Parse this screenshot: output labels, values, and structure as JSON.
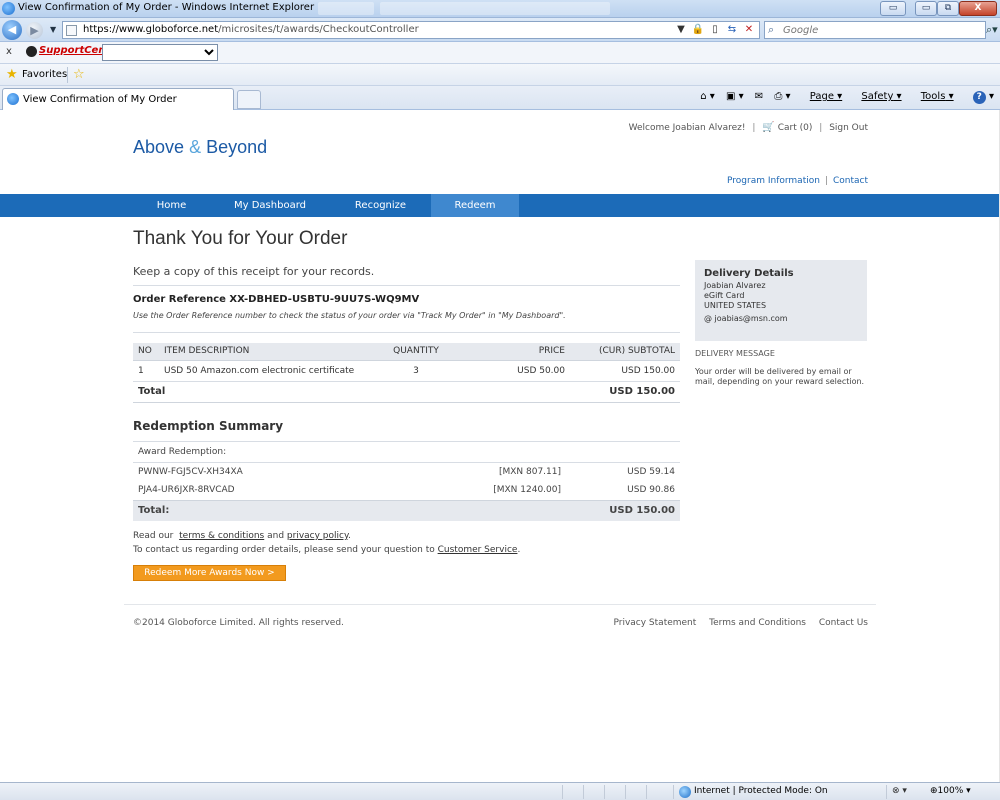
{
  "window": {
    "title": "View Confirmation of My Order - Windows Internet Explorer",
    "minimize": "▭",
    "restore": "⧉",
    "close": "X"
  },
  "address": {
    "url_host": "https://www.globoforce.net",
    "url_path": "/microsites/t/awards/CheckoutController",
    "search_placeholder": "Google"
  },
  "links_bar": {
    "close": "x",
    "label": "SupportCentral"
  },
  "favorites": {
    "label": "Favorites"
  },
  "tab": {
    "label": "View Confirmation of My Order"
  },
  "command_bar": {
    "page": "Page",
    "safety": "Safety",
    "tools": "Tools",
    "help": "?"
  },
  "header": {
    "welcome": "Welcome Joabian Alvarez!",
    "cart": "Cart (0)",
    "sign_out": "Sign Out",
    "logo_part1": "Above",
    "logo_amp": "&",
    "logo_part2": "Beyond",
    "program_info": "Program Information",
    "contact": "Contact"
  },
  "nav": {
    "items": [
      "Home",
      "My Dashboard",
      "Recognize",
      "Redeem"
    ],
    "active": "Redeem"
  },
  "main": {
    "title": "Thank You for Your Order",
    "receipt_note": "Keep a copy of this receipt for your records.",
    "order_reference": "Order Reference XX-DBHED-USBTU-9UU7S-WQ9MV",
    "order_hint": "Use the Order Reference number to check the status of your order via \"Track My Order\" in \"My Dashboard\"."
  },
  "items_table": {
    "headers": [
      "NO",
      "ITEM DESCRIPTION",
      "QUANTITY",
      "PRICE",
      "(CUR) SUBTOTAL"
    ],
    "rows": [
      {
        "no": "1",
        "description": "USD 50 Amazon.com electronic certificate",
        "quantity": "3",
        "price": "USD 50.00",
        "subtotal": "USD 150.00"
      }
    ],
    "total_label": "Total",
    "total_value": "USD 150.00"
  },
  "redemption": {
    "title": "Redemption Summary",
    "subheading": "Award Redemption:",
    "rows": [
      {
        "code": "PWNW-FGJ5CV-XH34XA",
        "local": "[MXN 807.11]",
        "usd": "USD 59.14"
      },
      {
        "code": "PJA4-UR6JXR-8RVCAD",
        "local": "[MXN 1240.00]",
        "usd": "USD 90.86"
      }
    ],
    "total_label": "Total:",
    "total_value": "USD 150.00"
  },
  "legal": {
    "read_prefix": "Read our",
    "terms": "terms & conditions",
    "and": "and",
    "privacy": "privacy policy",
    "period": ".",
    "contact_prefix": "To contact us regarding order details, please send your question to",
    "customer_service": "Customer Service",
    "cta": "Redeem More Awards Now >"
  },
  "delivery": {
    "title": "Delivery Details",
    "name": "Joabian Alvarez",
    "type": "eGift Card",
    "country": "UNITED STATES",
    "email": "@ joabias@msn.com",
    "message_title": "DELIVERY MESSAGE",
    "message": "Your order will be delivered by email or mail, depending on your reward selection."
  },
  "footer": {
    "copyright": "©2014 Globoforce Limited. All rights reserved.",
    "privacy": "Privacy Statement",
    "terms": "Terms and Conditions",
    "contact": "Contact Us"
  },
  "status": {
    "zone": "Internet | Protected Mode: On",
    "zoom": "100%"
  },
  "colors": {
    "nav_bar": "#1c6bb8",
    "nav_active": "#3f88cf",
    "cta": "#f29a1e",
    "logo": "#1c5aa5",
    "panel": "#e6e9ee"
  }
}
